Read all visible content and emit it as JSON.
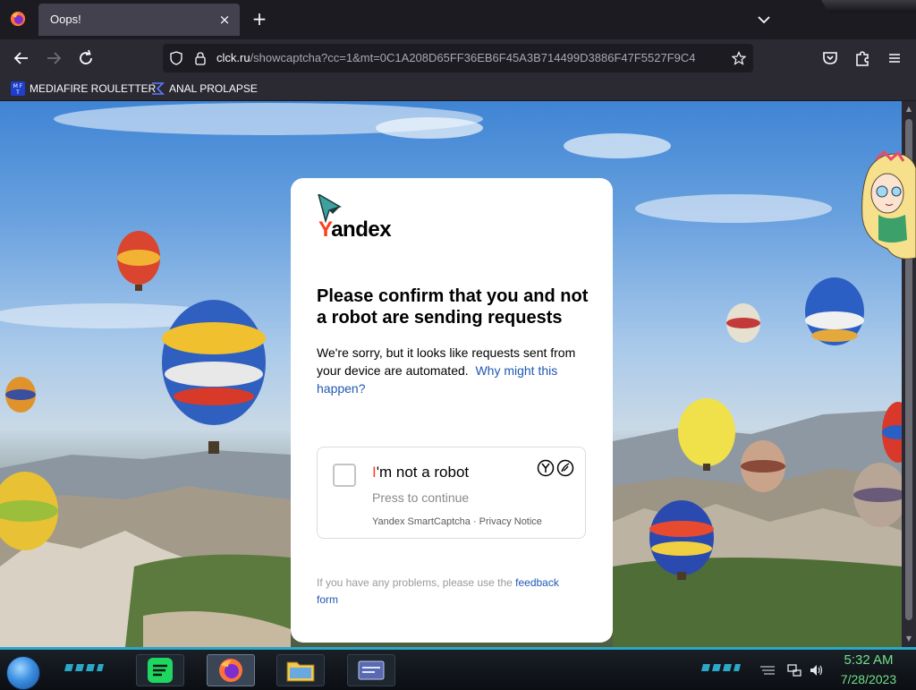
{
  "browser": {
    "tab_title": "Oops!",
    "new_tab_label": "+",
    "close_label": "×",
    "url_host": "clck.ru",
    "url_path": "/showcaptcha?cc=1&mt=0C1A208D65FF36EB6F45A3B714499D3886F47F5527F9C4",
    "bookmarks": [
      {
        "label": "MEDIAFIRE ROULETTER",
        "icon": "mediafire-icon"
      },
      {
        "label": "ANAL PROLAPSE",
        "icon": "sigma-icon"
      }
    ]
  },
  "page": {
    "brand_y": "Y",
    "brand_rest": "andex",
    "title": "Please confirm that you and not a robot are sending requests",
    "body_text": "We're sorry, but it looks like requests sent from your device are automated.",
    "body_link": "Why might this happen?",
    "captcha": {
      "label_first": "I",
      "label_rest": "'m not a robot",
      "sub": "Press to continue",
      "footer": "Yandex SmartCaptcha · Privacy Notice"
    },
    "footer_text": "If you have any problems, please use the",
    "footer_link": "feedback form"
  },
  "taskbar": {
    "time": "5:32 AM",
    "date": "7/28/2023"
  },
  "colors": {
    "yandex_red": "#fc3f1d",
    "link_blue": "#1f58b3",
    "clock_green": "#6fe08a",
    "taskbar_accent": "#2aa7c9"
  }
}
